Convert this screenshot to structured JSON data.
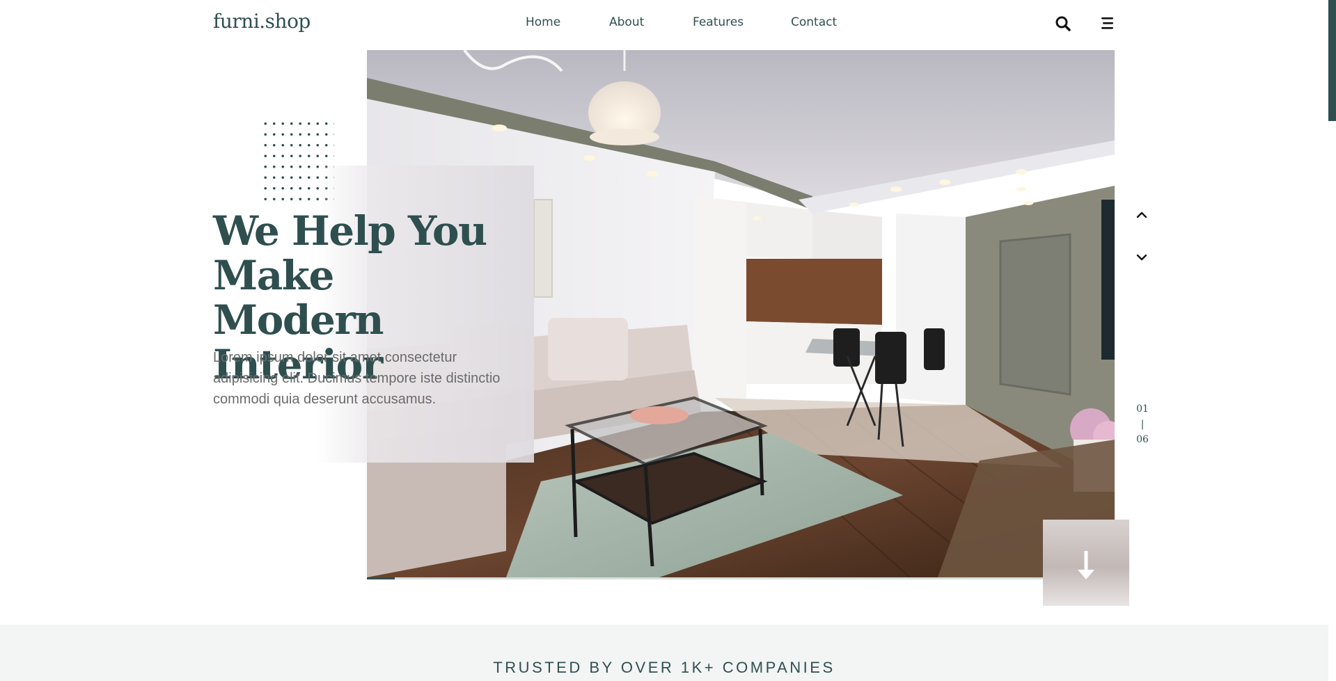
{
  "brand": {
    "logo": "furni.shop"
  },
  "nav": {
    "items": [
      {
        "label": "Home"
      },
      {
        "label": "About"
      },
      {
        "label": "Features"
      },
      {
        "label": "Contact"
      }
    ]
  },
  "header_icons": {
    "search": "search-icon",
    "menu": "hamburger-menu-icon"
  },
  "hero": {
    "headline_line1": "We Help You",
    "headline_line2": "Make Modern",
    "headline_line3": "Interior",
    "description": "Lorem ipsum dolor sit amet consectetur adipisicing elit. Ducimus tempore iste distinctio commodi quia deserunt accusamus.",
    "slider": {
      "current": "01",
      "separator": "|",
      "total": "06",
      "prev_icon": "chevron-up-icon",
      "next_icon": "chevron-down-icon"
    },
    "scroll_icon": "arrow-down-icon"
  },
  "trusted": {
    "label": "TRUSTED BY OVER 1K+ COMPANIES"
  },
  "colors": {
    "primary": "#2f4f4f",
    "text_muted": "#6b6b6b",
    "band_bg": "#f3f4f4"
  }
}
